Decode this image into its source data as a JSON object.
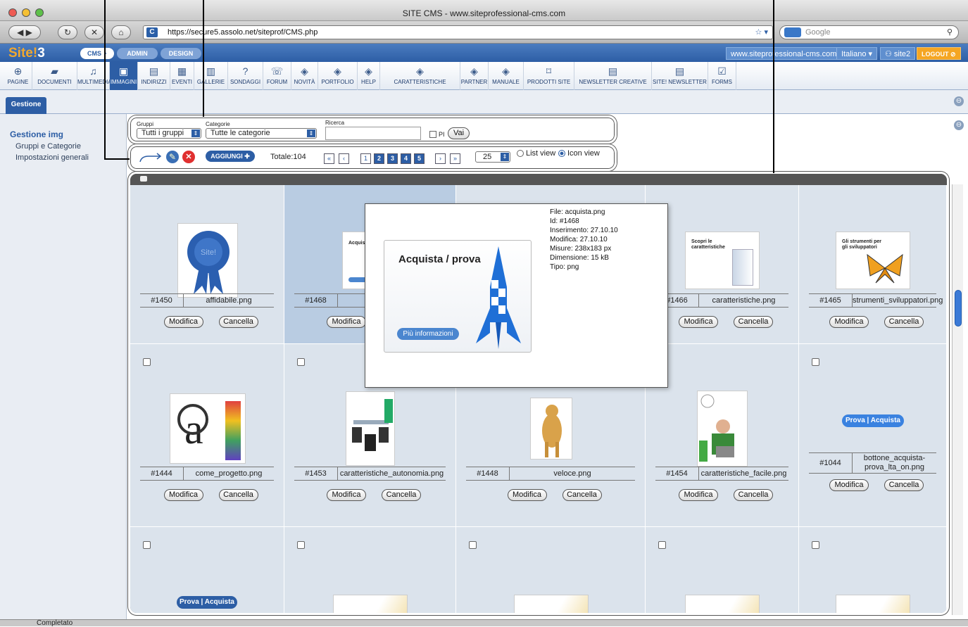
{
  "window": {
    "title": "SITE CMS - www.siteprofessional-cms.com",
    "url": "https://secure5.assolo.net/siteprof/CMS.php",
    "search_placeholder": "Google",
    "status": "Completato"
  },
  "app": {
    "logo_text": "Site!",
    "logo_num": "3",
    "tabs": [
      "CMS",
      "ADMIN",
      "DESIGN"
    ],
    "site_link": "www.siteprofessional-cms.com",
    "language": "Italiano",
    "user": "site2",
    "logout": "LOGOUT"
  },
  "toolbar": [
    {
      "label": "PAGINE",
      "icon": "globe-icon",
      "glyph": "⊕"
    },
    {
      "label": "DOCUMENTI",
      "icon": "folder-icon",
      "glyph": "▰"
    },
    {
      "label": "MULTIMEDIA",
      "icon": "media-icon",
      "glyph": "♫"
    },
    {
      "label": "IMMAGINI",
      "icon": "image-icon",
      "glyph": "▣"
    },
    {
      "label": "INDIRIZZI",
      "icon": "address-icon",
      "glyph": "▤"
    },
    {
      "label": "EVENTI",
      "icon": "calendar-icon",
      "glyph": "▦"
    },
    {
      "label": "GALLERIE",
      "icon": "gallery-icon",
      "glyph": "▥"
    },
    {
      "label": "SONDAGGI",
      "icon": "poll-icon",
      "glyph": "?"
    },
    {
      "label": "FORUM",
      "icon": "forum-icon",
      "glyph": "☏"
    },
    {
      "label": "NOVITÀ",
      "icon": "news-icon",
      "glyph": "◈"
    },
    {
      "label": "PORTFOLIO",
      "icon": "portfolio-icon",
      "glyph": "◈"
    },
    {
      "label": "HELP",
      "icon": "help-icon",
      "glyph": "◈"
    },
    {
      "label": "CARATTERISTICHE",
      "icon": "features-icon",
      "glyph": "◈"
    },
    {
      "label": "PARTNER",
      "icon": "partner-icon",
      "glyph": "◈"
    },
    {
      "label": "MANUALE",
      "icon": "manual-icon",
      "glyph": "◈"
    },
    {
      "label": "PRODOTTI SITE",
      "icon": "cart-icon",
      "glyph": "⌑"
    },
    {
      "label": "NEWSLETTER CREATIVE",
      "icon": "newsletter-icon",
      "glyph": "▤"
    },
    {
      "label": "SITE! NEWSLETTER",
      "icon": "newsletter-icon",
      "glyph": "▤"
    },
    {
      "label": "FORMS",
      "icon": "checkbox-icon",
      "glyph": "☑"
    }
  ],
  "tab": "Gestione",
  "sidebar": {
    "heading": "Gestione img",
    "items": [
      "Gruppi e Categorie",
      "Impostazioni generali"
    ]
  },
  "filters": {
    "groups_label": "Gruppi",
    "groups_value": "Tutti i gruppi",
    "categories_label": "Categorie",
    "categories_value": "Tutte le categorie",
    "search_label": "Ricerca",
    "search_value": "",
    "pi_label": "PI",
    "go": "Vai"
  },
  "list": {
    "add": "AGGIUNGI",
    "total": "Totale:104",
    "pages": [
      "1",
      "2",
      "3",
      "4",
      "5"
    ],
    "per_page": "25",
    "list_view": "List view",
    "icon_view": "Icon view"
  },
  "buttons": {
    "edit": "Modifica",
    "delete": "Cancella"
  },
  "popup": {
    "file": "File: acquista.png",
    "id": "Id: #1468",
    "inserted": "Inserimento: 27.10.10",
    "modified": "Modifica: 27.10.10",
    "size": "Misure: 238x183 px",
    "weight": "Dimensione: 15 kB",
    "type": "Tipo: png",
    "thumb_title": "Acquista / prova",
    "thumb_button": "Più informazioni"
  },
  "images": [
    {
      "id": "#1450",
      "name": "affidabile.png",
      "kind": "seal"
    },
    {
      "id": "#1468",
      "name": "acquista.png",
      "kind": "acq"
    },
    {
      "id": "",
      "name": "",
      "kind": "none"
    },
    {
      "id": "#1466",
      "name": "caratteristiche.png",
      "kind": "box"
    },
    {
      "id": "#1465",
      "name": "strumenti_sviluppatori.png",
      "kind": "butterfly"
    },
    {
      "id": "#1444",
      "name": "come_progetto.png",
      "kind": "letter"
    },
    {
      "id": "#1453",
      "name": "caratteristiche_autonomia.png",
      "kind": "chairs"
    },
    {
      "id": "#1448",
      "name": "veloce.png",
      "kind": "cheetah"
    },
    {
      "id": "#1454",
      "name": "caratteristiche_facile.png",
      "kind": "man"
    },
    {
      "id": "#1044",
      "name": "bottone_acquista-prova_lta_on.png",
      "kind": "btn"
    }
  ],
  "thumb_texts": {
    "acq_small": "Acquista /",
    "box_small": "Scopri le caratteristiche",
    "butterfly_small": "Gli strumenti per gli sviluppatori",
    "btn_label": "Prova | Acquista",
    "row3_btn": "Prova | Acquista",
    "site_seal": "Site!"
  },
  "colors": {
    "accent": "#2d5ea5",
    "logo": "#f0a830",
    "logout": "#f5a623"
  }
}
